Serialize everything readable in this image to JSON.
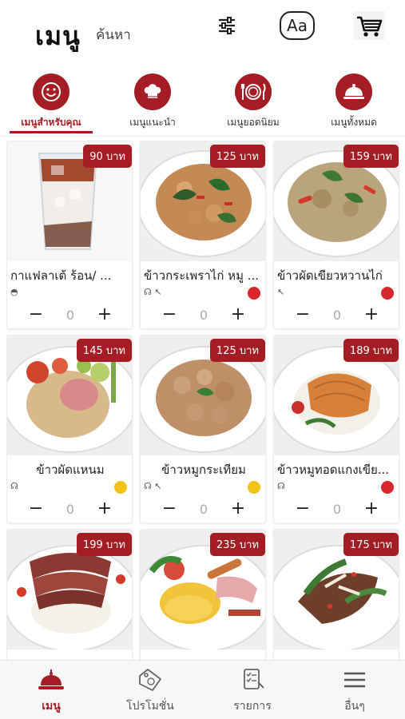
{
  "header": {
    "title": "เมนู",
    "search_label": "ค้นหา",
    "font_button_label": "Aa",
    "icons": [
      "filter-icon",
      "font-size-icon",
      "cart-icon"
    ]
  },
  "tabs": [
    {
      "label": "เมนูสำหรับคุณ",
      "icon": "smile-icon",
      "active": true
    },
    {
      "label": "เมนูแนะนำ",
      "icon": "chef-hat-icon",
      "active": false
    },
    {
      "label": "เมนูยอดนิยม",
      "icon": "plate-cutlery-icon",
      "active": false
    },
    {
      "label": "เมนูทั้งหมด",
      "icon": "cloche-icon",
      "active": false
    }
  ],
  "menu_items": [
    {
      "name": "กาแฟลาเต้ ร้อน/ ...",
      "price": "90 บาท",
      "tags": "◓",
      "qty": "0",
      "indicator": "",
      "image": "iced-latte"
    },
    {
      "name": "ข้าวกระเพราไก่ หมู ...",
      "price": "125 บาท",
      "tags": "☊ ↖",
      "qty": "0",
      "indicator": "red",
      "image": "basil-chicken"
    },
    {
      "name": "ข้าวผัดเขียวหวานไก่",
      "price": "159 บาท",
      "tags": "↖",
      "qty": "0",
      "indicator": "red",
      "image": "green-curry-rice"
    },
    {
      "name": "ข้าวผัดแหนม",
      "price": "145 บาท",
      "tags": "☊",
      "qty": "0",
      "indicator": "yellow",
      "image": "fried-rice-ham"
    },
    {
      "name": "ข้าวหมูกระเทียม",
      "price": "125 บาท",
      "tags": "☊ ↖",
      "qty": "0",
      "indicator": "yellow",
      "image": "garlic-pork"
    },
    {
      "name": "ข้าวหมูทอดแกงเขีย...",
      "price": "189 บาท",
      "tags": "☊",
      "qty": "0",
      "indicator": "red",
      "image": "fried-pork-cutlet"
    },
    {
      "name": "",
      "price": "199 บาท",
      "tags": "",
      "qty": "0",
      "indicator": "",
      "image": "sliced-beef"
    },
    {
      "name": "",
      "price": "235 บาท",
      "tags": "",
      "qty": "0",
      "indicator": "",
      "image": "breakfast-plate"
    },
    {
      "name": "",
      "price": "175 บาท",
      "tags": "",
      "qty": "0",
      "indicator": "",
      "image": "spicy-salad"
    }
  ],
  "stepper": {
    "minus": "−",
    "plus": "+"
  },
  "bottom_nav": [
    {
      "label": "เมนู",
      "icon": "cloche-icon",
      "active": true
    },
    {
      "label": "โปรโมชั่น",
      "icon": "promo-tag-icon",
      "active": false
    },
    {
      "label": "รายการ",
      "icon": "order-list-icon",
      "active": false
    },
    {
      "label": "อื่นๆ",
      "icon": "hamburger-menu-icon",
      "active": false
    }
  ],
  "colors": {
    "accent": "#a41d24",
    "chili": "#d8262d",
    "mild": "#f2c21b"
  }
}
